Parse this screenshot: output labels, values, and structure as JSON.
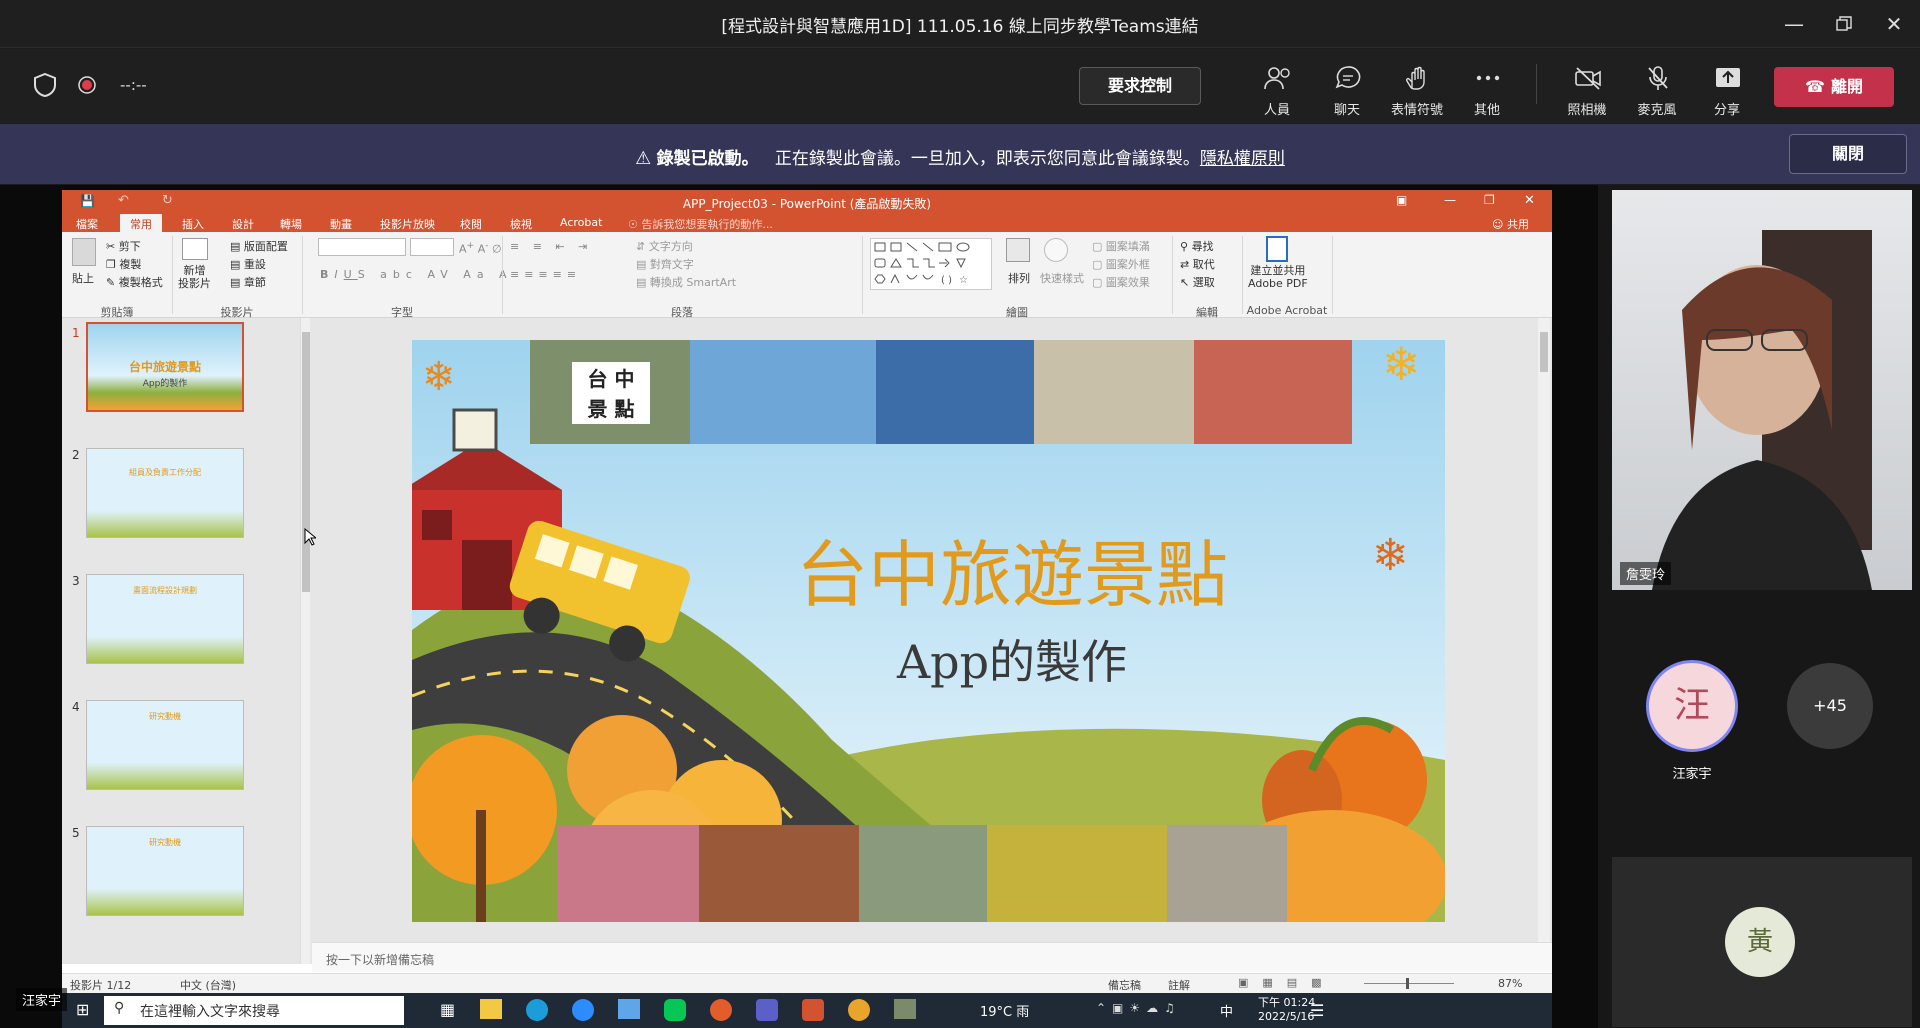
{
  "window": {
    "title": "[程式設計與智慧應用1D] 111.05.16 線上同步教學Teams連結"
  },
  "meeting": {
    "timer": "--:--",
    "request_control": "要求控制",
    "buttons": [
      {
        "label": "人員",
        "icon": "people-icon"
      },
      {
        "label": "聊天",
        "icon": "chat-icon"
      },
      {
        "label": "表情符號",
        "icon": "reaction-icon"
      },
      {
        "label": "其他",
        "icon": "more-icon"
      },
      {
        "label": "照相機",
        "icon": "camera-off-icon"
      },
      {
        "label": "麥克風",
        "icon": "mic-off-icon"
      },
      {
        "label": "分享",
        "icon": "share-icon"
      }
    ],
    "leave": "離開"
  },
  "banner": {
    "bold": "錄製已啟動。",
    "text": "正在錄製此會議。一旦加入，即表示您同意此會議錄製。",
    "link": "隱私權原則",
    "close": "關閉"
  },
  "powerpoint": {
    "title": "APP_Project03 - PowerPoint (產品啟動失敗)",
    "share": "共用",
    "tabs": [
      "檔案",
      "常用",
      "插入",
      "設計",
      "轉場",
      "動畫",
      "投影片放映",
      "校閱",
      "檢視",
      "Acrobat"
    ],
    "active_tab": "常用",
    "tell_me": "告訴我您想要執行的動作...",
    "ribbon": {
      "paste": "貼上",
      "cut": "剪下",
      "copy": "複製",
      "format_painter": "複製格式",
      "new_slide": "新增\n投影片",
      "layout": "版面配置",
      "reset": "重設",
      "section": "章節",
      "text_direction": "文字方向",
      "align_text": "對齊文字",
      "convert_smartart": "轉換成 SmartArt",
      "arrange": "排列",
      "quick_styles": "快速樣式",
      "shape_fill": "圖案填滿",
      "shape_outline": "圖案外框",
      "shape_effects": "圖案效果",
      "find": "尋找",
      "replace": "取代",
      "select": "選取",
      "create_pdf": "建立並共用\nAdobe PDF",
      "groups": [
        "剪貼簿",
        "投影片",
        "字型",
        "段落",
        "繪圖",
        "編輯",
        "Adobe Acrobat"
      ]
    },
    "thumbnails": [
      {
        "num": "1",
        "title": "台中旅遊景點",
        "sub": "App的製作"
      },
      {
        "num": "2",
        "title": "組員及負責工作分配"
      },
      {
        "num": "3",
        "title": "畫面流程設計規劃"
      },
      {
        "num": "4",
        "title": "研究動機"
      },
      {
        "num": "5",
        "title": "研究動機"
      }
    ],
    "slide": {
      "badge": "台 中\n景 點",
      "title": "台中旅遊景點",
      "subtitle": "App的製作"
    },
    "notes_placeholder": "按一下以新增備忘稿",
    "status": {
      "slide_count": "投影片 1/12",
      "language": "中文 (台灣)",
      "notes": "備忘稿",
      "comments": "註解",
      "zoom": "87%"
    }
  },
  "taskbar": {
    "search_placeholder": "在這裡輸入文字來搜尋",
    "weather": "19°C 雨",
    "ime": "中",
    "time": "下午 01:24",
    "date": "2022/5/16"
  },
  "participants": {
    "video_name": "詹雯玲",
    "presenter_initial": "汪",
    "presenter_name": "汪家宇",
    "more_count": "+45",
    "other_initial": "黃",
    "self_name": "汪家宇"
  },
  "colors": {
    "ppt_orange": "#d35230",
    "leave_red": "#c4314b",
    "banner_bg": "#353657",
    "slide_title": "#e29a1c"
  }
}
